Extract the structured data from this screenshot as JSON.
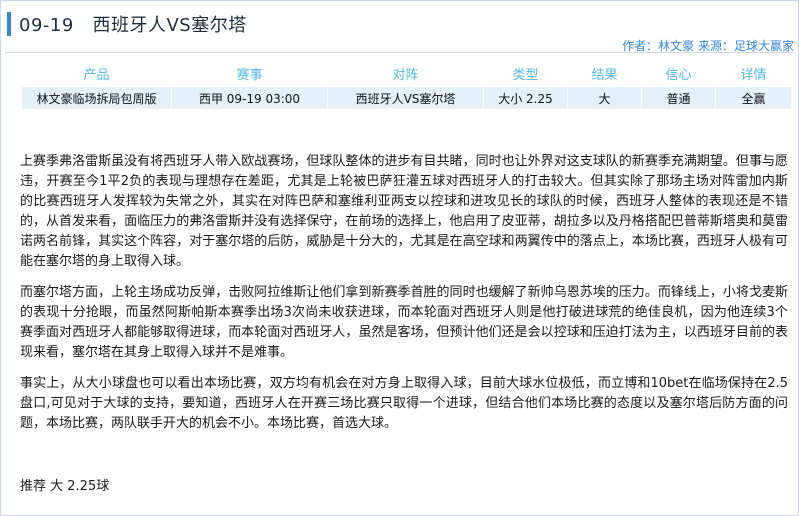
{
  "title": "09-19   西班牙人VS塞尔塔",
  "byline": "作者：林文豪 来源：足球大赢家",
  "table": {
    "headers": [
      "产品",
      "赛事",
      "对阵",
      "类型",
      "结果",
      "信心",
      "详情"
    ],
    "row": [
      "林文豪临场拆局包周版",
      "西甲 09-19 03:00",
      "西班牙人VS塞尔塔",
      "大小 2.25",
      "大",
      "普通",
      "全赢"
    ]
  },
  "paragraphs": [
    "上赛季弗洛雷斯虽没有将西班牙人带入欧战赛场，但球队整体的进步有目共睹，同时也让外界对这支球队的新赛季充满期望。但事与愿违，开赛至今1平2负的表现与理想存在差距，尤其是上轮被巴萨狂灌五球对西班牙人的打击较大。但其实除了那场主场对阵雷加内斯的比赛西班牙人发挥较为失常之外，其实在对阵巴萨和塞维利亚两支以控球和进攻见长的球队的时候，西班牙人整体的表现还是不错的，从首发来看，面临压力的弗洛雷斯并没有选择保守，在前场的选择上，他启用了皮亚蒂，胡拉多以及丹格搭配巴普蒂斯塔奥和莫雷诺两名前锋，其实这个阵容，对于塞尔塔的后防，威胁是十分大的，尤其是在高空球和两翼传中的落点上，本场比赛，西班牙人极有可能在塞尔塔的身上取得入球。",
    "而塞尔塔方面，上轮主场成功反弹，击败阿拉维斯让他们拿到新赛季首胜的同时也缓解了新帅乌恩苏埃的压力。而锋线上，小将戈麦斯的表现十分抢眼，而虽然阿斯帕斯本赛季出场3次尚未收获进球，而本轮面对西班牙人则是他打破进球荒的绝佳良机，因为他连续3个赛季面对西班牙人都能够取得进球，而本轮面对西班牙人，虽然是客场，但预计他们还是会以控球和压迫打法为主，以西班牙目前的表现来看，塞尔塔在其身上取得入球并不是难事。",
    "事实上，从大小球盘也可以看出本场比赛，双方均有机会在对方身上取得入球，目前大球水位极低，而立博和10bet在临场保持在2.5盘口,可见对于大球的支持，要知道，西班牙人在开赛三场比赛只取得一个进球，但结合他们本场比赛的态度以及塞尔塔后防方面的问题，本场比赛，两队联手开大的机会不小。本场比赛，首选大球。"
  ],
  "recommendation": "推荐 大 2.25球",
  "colors": {
    "accent": "#3a86d4",
    "header_text": "#58b7e6",
    "row_bg": "#e4f1fb"
  }
}
